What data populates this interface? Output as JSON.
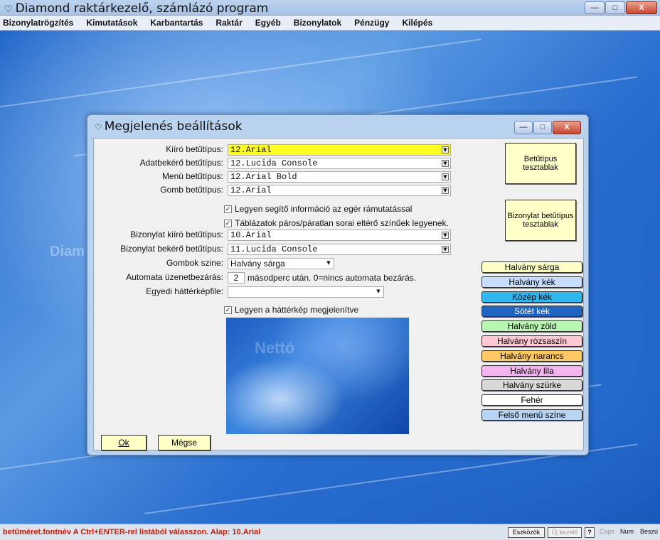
{
  "app": {
    "title": "Diamond raktárkezelő, számlázó program",
    "title_buttons": [
      "—",
      "□",
      "X"
    ]
  },
  "menu": [
    "Bizonylatrögzítés",
    "Kimutatások",
    "Karbantartás",
    "Raktár",
    "Egyéb",
    "Bizonylatok",
    "Pénzügy",
    "Kilépés"
  ],
  "background_text": "Diam",
  "dialog": {
    "title": "Megjelenés beállítások",
    "fields": {
      "kiro": {
        "label": "Kiíró betűtípus:",
        "value": "12.Arial"
      },
      "adatbekero": {
        "label": "Adatbekérő betűtípus:",
        "value": "12.Lucida Console"
      },
      "menu": {
        "label": "Menü betűtípus:",
        "value": "12.Arial Bold"
      },
      "gomb": {
        "label": "Gomb betűtípus:",
        "value": "12.Arial"
      },
      "biz_kiro": {
        "label": "Bizonylat kiíró betűtípus:",
        "value": "10.Arial"
      },
      "biz_bekero": {
        "label": "Bizonylat bekérő betűtípus:",
        "value": "11.Lucida Console"
      },
      "gombok_szine": {
        "label": "Gombok szine:",
        "value": "Halvány sárga"
      },
      "automata": {
        "label": "Automata üzenetbezárás:",
        "value": "2",
        "suffix": "másodperc után. 0=nincs automata bezárás."
      },
      "hatterkep": {
        "label": "Egyedi háttérképfile:",
        "value": ""
      }
    },
    "checkboxes": {
      "segito": "Legyen segítő információ az egér rámutatással",
      "tablazatok": "Táblázatok páros/páratlan sorai eltérő színűek legyenek.",
      "hatterkep": "Legyen a háttérkép megjelenítve"
    },
    "buttons": {
      "betutipus": "Betűtípus tesztablak",
      "bizonylat": "Bizonylat betűtípus tesztablak",
      "ok": "Ok",
      "megse": "Mégse"
    },
    "preview_ghost_text": "Nettó",
    "colors": [
      {
        "label": "Halvány sárga",
        "color": "#ffffc8",
        "text": "#000000"
      },
      {
        "label": "Halvány kék",
        "color": "#c8dcff",
        "text": "#000000"
      },
      {
        "label": "Közép kék",
        "color": "#2fb8f0",
        "text": "#000000"
      },
      {
        "label": "Sötét kék",
        "color": "#1f64c0",
        "text": "#ffffff"
      },
      {
        "label": "Halvány zöld",
        "color": "#b8f5b0",
        "text": "#000000"
      },
      {
        "label": "Halvány rózsaszín",
        "color": "#ffc8d2",
        "text": "#000000"
      },
      {
        "label": "Halvány narancs",
        "color": "#ffc864",
        "text": "#000000"
      },
      {
        "label": "Halvány lila",
        "color": "#f5b4f0",
        "text": "#000000"
      },
      {
        "label": "Halvány szürke",
        "color": "#d8d8d8",
        "text": "#000000"
      },
      {
        "label": "Fehér",
        "color": "#ffffff",
        "text": "#000000"
      },
      {
        "label": "Felső menü színe",
        "color": "#b8d4f4",
        "text": "#000000"
      }
    ]
  },
  "status": {
    "message": "betűméret.fontnév  A Ctrl+ENTER-rel listából válasszon. Alap: 10.Arial",
    "eszkozok": "Eszközök",
    "ujkezelo": "Új kezelő",
    "help": "?",
    "caps": "Caps",
    "num": "Num",
    "besz": "Beszú"
  }
}
